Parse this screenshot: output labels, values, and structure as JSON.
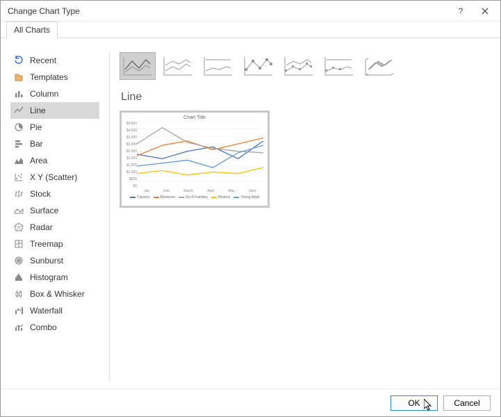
{
  "titlebar": {
    "title": "Change Chart Type"
  },
  "tabs": {
    "all_charts": "All Charts"
  },
  "sidebar": {
    "items": [
      {
        "label": "Recent"
      },
      {
        "label": "Templates"
      },
      {
        "label": "Column"
      },
      {
        "label": "Line"
      },
      {
        "label": "Pie"
      },
      {
        "label": "Bar"
      },
      {
        "label": "Area"
      },
      {
        "label": "X Y (Scatter)"
      },
      {
        "label": "Stock"
      },
      {
        "label": "Surface"
      },
      {
        "label": "Radar"
      },
      {
        "label": "Treemap"
      },
      {
        "label": "Sunburst"
      },
      {
        "label": "Histogram"
      },
      {
        "label": "Box & Whisker"
      },
      {
        "label": "Waterfall"
      },
      {
        "label": "Combo"
      }
    ]
  },
  "main": {
    "charttype_heading": "Line",
    "preview": {
      "title": "Chart Title",
      "ylabels": [
        "$4,500",
        "$4,000",
        "$3,500",
        "$3,000",
        "$2,500",
        "$2,000",
        "$1,500",
        "$1,000",
        "$500",
        "$0"
      ],
      "xlabels": [
        "Jan",
        "Feb",
        "March",
        "April",
        "May",
        "June"
      ],
      "legend": [
        "Classics",
        "Romance",
        "Sci-Fi Fantasy",
        "Mystery",
        "Young Adult"
      ],
      "colors": {
        "Classics": "#4573c4",
        "Romance": "#ed7d31",
        "Sci-Fi Fantasy": "#a5a5a5",
        "Mystery": "#ffc000",
        "Young Adult": "#5b9bd5"
      }
    }
  },
  "buttons": {
    "ok": "OK",
    "cancel": "Cancel"
  },
  "chart_data": {
    "type": "line",
    "title": "Chart Title",
    "xlabel": "",
    "ylabel": "",
    "ylim": [
      0,
      4500
    ],
    "categories": [
      "Jan",
      "Feb",
      "March",
      "April",
      "May",
      "June"
    ],
    "series": [
      {
        "name": "Classics",
        "values": [
          2300,
          2000,
          2500,
          2800,
          2000,
          3200
        ]
      },
      {
        "name": "Romance",
        "values": [
          2200,
          2900,
          3200,
          2600,
          3000,
          3400
        ]
      },
      {
        "name": "Sci-Fi Fantasy",
        "values": [
          3000,
          4100,
          3100,
          2700,
          2500,
          2400
        ]
      },
      {
        "name": "Mystery",
        "values": [
          1000,
          1200,
          900,
          1100,
          1000,
          1400
        ]
      },
      {
        "name": "Young Adult",
        "values": [
          1500,
          1700,
          1900,
          1400,
          2400,
          2900
        ]
      }
    ]
  }
}
